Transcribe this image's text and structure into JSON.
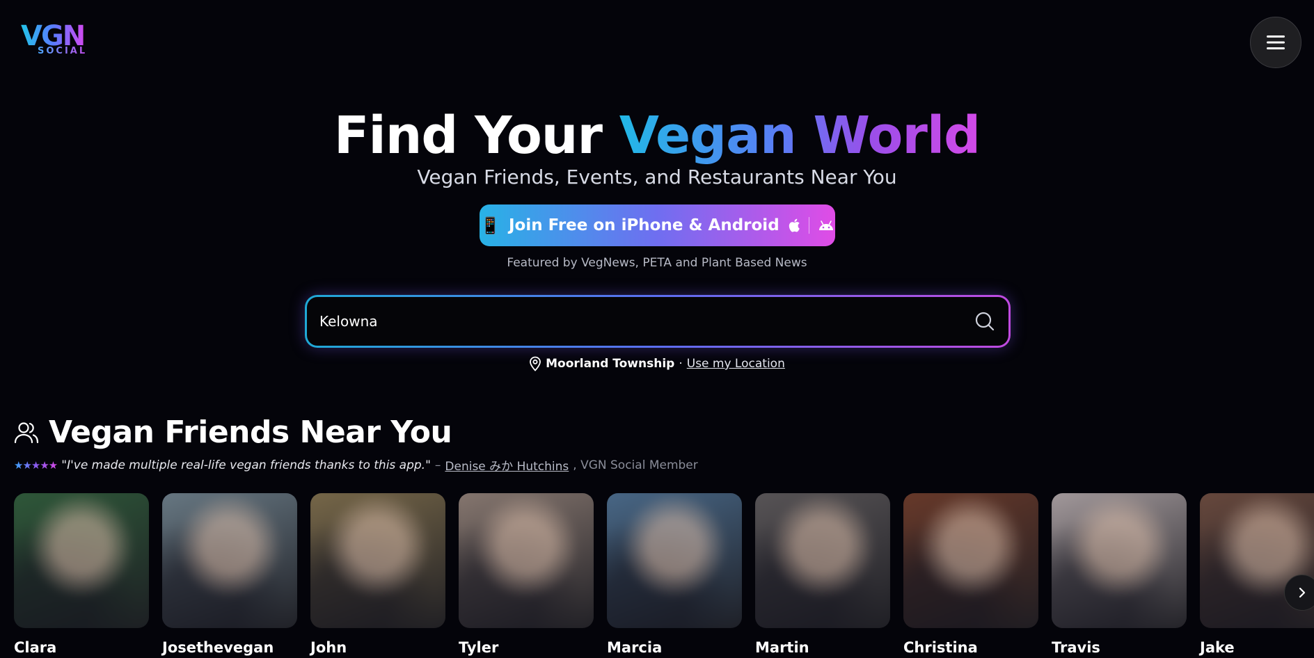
{
  "logo": {
    "main": "VGN",
    "sub": "SOCIAL"
  },
  "hero": {
    "title_plain": "Find Your ",
    "title_gradient": "Vegan World",
    "subtitle": "Vegan Friends, Events, and Restaurants Near You",
    "join_button_icon": "📱",
    "join_button_label": "Join Free on iPhone & Android",
    "featured_text": "Featured by VegNews, PETA and Plant Based News"
  },
  "search": {
    "value": "Kelowna"
  },
  "location": {
    "current": "Moorland Township",
    "separator": "·",
    "use_location_label": "Use my Location"
  },
  "friends_section": {
    "title": "Vegan Friends Near You",
    "stars": "★★★★★",
    "quote": "\"I've made multiple real-life vegan friends thanks to this app.\"",
    "dash": "–",
    "author": "Denise みか Hutchins",
    "member_label": ", VGN Social Member",
    "friends": [
      {
        "name": "Clara",
        "tint": "#2f5a3a"
      },
      {
        "name": "Josethevegan",
        "tint": "#6a7b86"
      },
      {
        "name": "John",
        "tint": "#7a6a4a"
      },
      {
        "name": "Tyler",
        "tint": "#8a7a72"
      },
      {
        "name": "Marcia",
        "tint": "#4a6a8a"
      },
      {
        "name": "Martin",
        "tint": "#5a5658"
      },
      {
        "name": "Christina",
        "tint": "#6a3a2a"
      },
      {
        "name": "Travis",
        "tint": "#a89ea0"
      },
      {
        "name": "Jake",
        "tint": "#6a4a3e"
      }
    ]
  }
}
